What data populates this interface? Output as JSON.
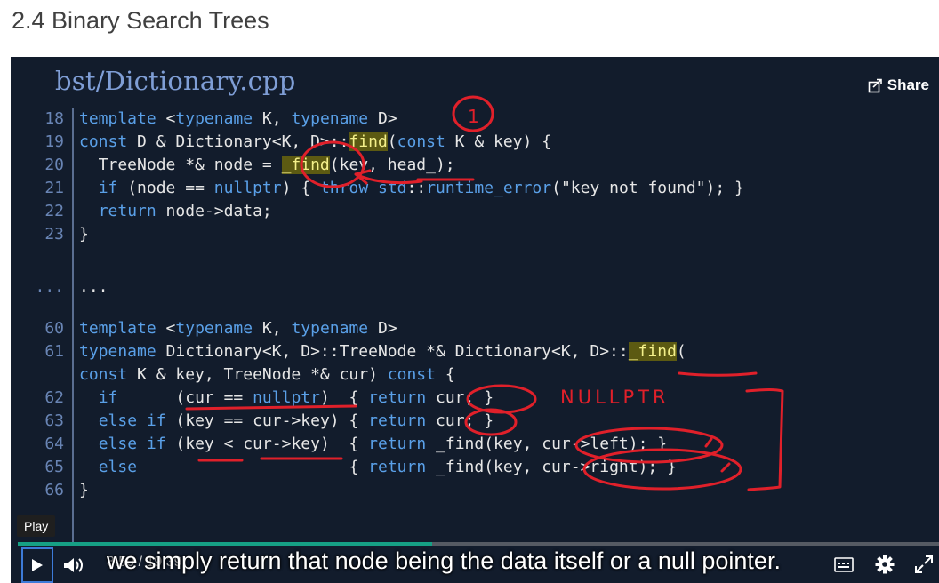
{
  "page": {
    "title": "2.4 Binary Search Trees"
  },
  "video": {
    "file_title": "bst/Dictionary.cpp",
    "share_label": "Share",
    "tooltip": "Play",
    "time_current": "8:50",
    "time_sep": " / ",
    "time_total": "19:39",
    "progress": 0.45,
    "caption": "we simply return that node being the data itself or a null pointer.",
    "annotation_number": "1",
    "annotation_word": "NULLPTR"
  },
  "code_lines": [
    {
      "ln": "18",
      "code": "template <typename K, typename D>"
    },
    {
      "ln": "19",
      "code": "const D & Dictionary<K, D>::find(const K & key) {"
    },
    {
      "ln": "20",
      "code": "  TreeNode *& node = _find(key, head_);"
    },
    {
      "ln": "21",
      "code": "  if (node == nullptr) { throw std::runtime_error(\"key not found\"); }"
    },
    {
      "ln": "22",
      "code": "  return node->data;"
    },
    {
      "ln": "23",
      "code": "}"
    },
    {
      "ln": "...",
      "code": "..."
    },
    {
      "ln": "60",
      "code": "template <typename K, typename D>"
    },
    {
      "ln": "61",
      "code": "typename Dictionary<K, D>::TreeNode *& Dictionary<K, D>::_find("
    },
    {
      "ln": "",
      "code": "const K & key, TreeNode *& cur) const {"
    },
    {
      "ln": "62",
      "code": "  if      (cur == nullptr)  { return cur; }"
    },
    {
      "ln": "63",
      "code": "  else if (key == cur->key) { return cur; }"
    },
    {
      "ln": "64",
      "code": "  else if (key < cur->key)  { return _find(key, cur->left); }"
    },
    {
      "ln": "65",
      "code": "  else                      { return _find(key, cur->right); }"
    },
    {
      "ln": "66",
      "code": "}"
    }
  ],
  "colors": {
    "keyword": "#5aa0e8",
    "text": "#e6e6e6",
    "line_number": "#6985b5",
    "highlight_bg": "#5c5a12",
    "highlight_fg": "#f4f08a",
    "annotation": "#e0202a",
    "progress": "#16a085"
  },
  "icons": {
    "share": "share-icon",
    "play": "play-icon",
    "volume": "volume-icon",
    "captions": "captions-icon",
    "settings": "gear-icon",
    "fullscreen": "fullscreen-icon"
  }
}
